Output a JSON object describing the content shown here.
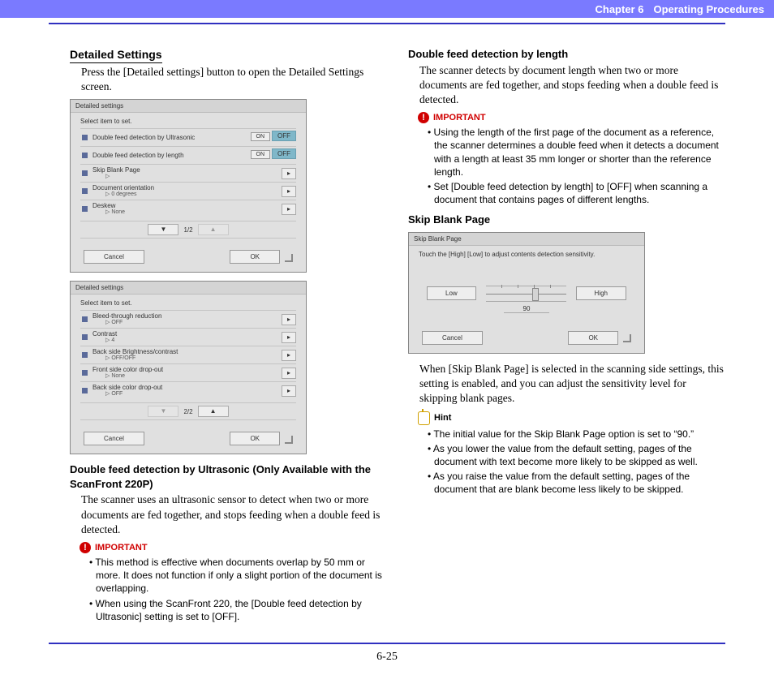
{
  "header": {
    "chapter": "Chapter 6",
    "title": "Operating Procedures"
  },
  "left": {
    "h_detailed": "Detailed Settings",
    "p_detailed": "Press the [Detailed settings] button to open the Detailed Settings screen.",
    "shot1": {
      "title": "Detailed settings",
      "select": "Select item to set.",
      "i1": "Double feed detection by Ultrasonic",
      "i2": "Double feed detection by length",
      "i3": "Skip Blank Page",
      "i3v": "▷",
      "i4": "Document orientation",
      "i4v": "▷  0 degrees",
      "i5": "Deskew",
      "i5v": "▷  None",
      "on": "ON",
      "off": "OFF",
      "page": "1/2",
      "ok": "OK",
      "cancel": "Cancel"
    },
    "shot2": {
      "title": "Detailed settings",
      "select": "Select item to set.",
      "i1": "Bleed-through reduction",
      "i1v": "▷  OFF",
      "i2": "Contrast",
      "i2v": "▷  4",
      "i3": "Back side Brightness/contrast",
      "i3v": "▷  OFF/OFF",
      "i4": "Front side color drop-out",
      "i4v": "▷  None",
      "i5": "Back side color drop-out",
      "i5v": "▷  OFF",
      "page": "2/2",
      "ok": "OK",
      "cancel": "Cancel"
    },
    "h_ultra": "Double feed detection by Ultrasonic (Only Available with the ScanFront 220P)",
    "p_ultra": "The scanner uses an ultrasonic sensor to detect when two or more documents are fed together, and stops feeding when a double feed is detected.",
    "important": "IMPORTANT",
    "u_b1": "This method is effective when documents overlap by 50 mm or more. It does not function if only a slight portion of the document is overlapping.",
    "u_b2": "When using the ScanFront 220, the [Double feed detection by Ultrasonic] setting is set to [OFF]."
  },
  "right": {
    "h_len": "Double feed detection by length",
    "p_len": "The scanner detects by document length when two or more documents are fed together, and stops feeding when a double feed is detected.",
    "important": "IMPORTANT",
    "l_b1": "Using the length of the first page of the document as a reference, the scanner determines a double feed when it detects a document with a length at least 35 mm longer or shorter than the reference length.",
    "l_b2": "Set [Double feed detection by length] to [OFF] when scanning a document that contains pages of different lengths.",
    "h_skip": "Skip Blank Page",
    "shot3": {
      "title": "Skip Blank Page",
      "msg": "Touch the [High] [Low] to adjust contents detection sensitivity.",
      "low": "Low",
      "high": "High",
      "val": "90",
      "ok": "OK",
      "cancel": "Cancel"
    },
    "p_skip": "When [Skip Blank Page] is selected in the scanning side settings, this setting is enabled, and you can adjust the sensitivity level for skipping blank pages.",
    "hint": "Hint",
    "h_b1": "The initial value for the Skip Blank Page option is set to “90.”",
    "h_b2": "As you lower the value from the default setting, pages of the document with text become more likely to be skipped as well.",
    "h_b3": "As you raise the value from the default setting, pages of the document that are blank become less likely to be skipped."
  },
  "pagenum": "6-25"
}
